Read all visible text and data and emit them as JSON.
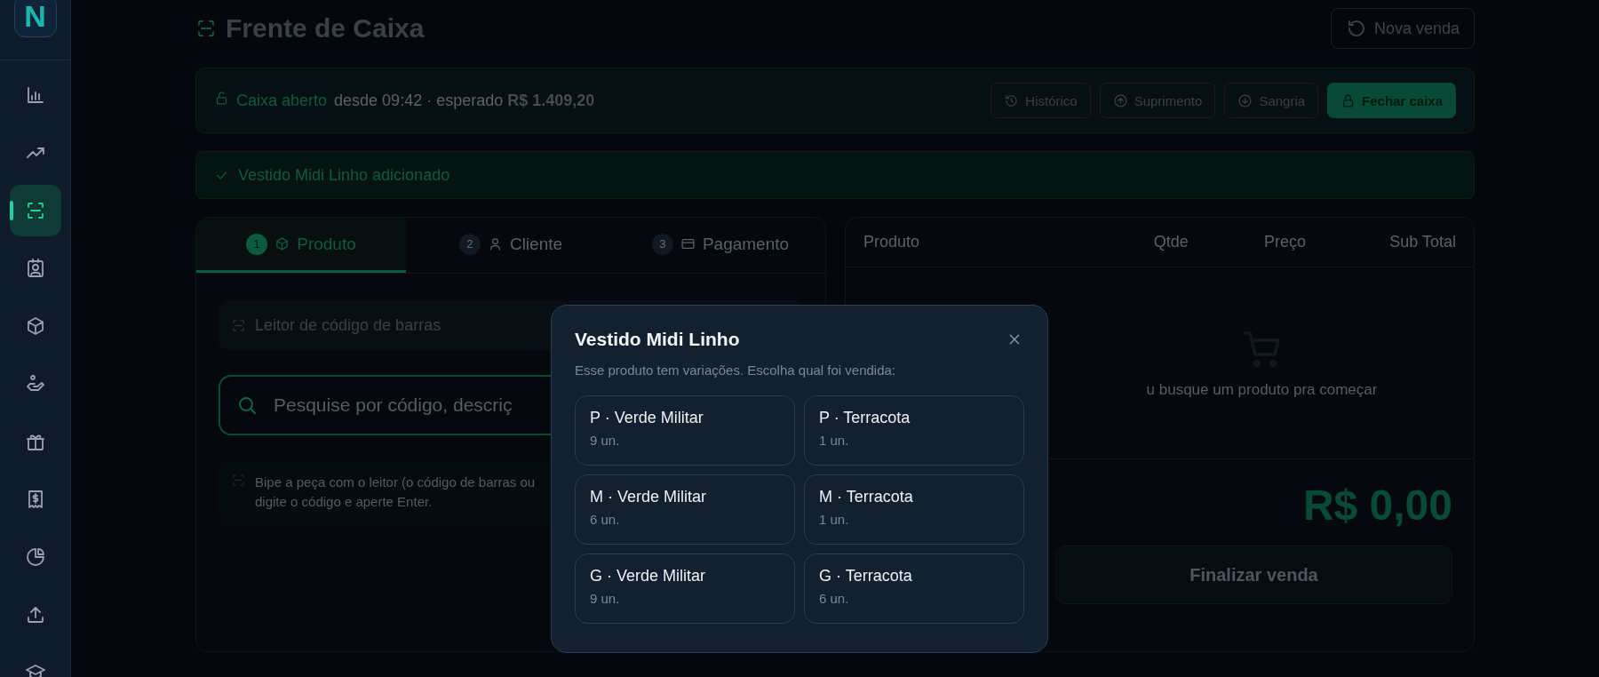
{
  "sidebar": {
    "logo": "N",
    "items": [
      {
        "selected": false
      },
      {
        "selected": false
      },
      {
        "selected": true
      },
      {
        "selected": false
      },
      {
        "selected": false
      },
      {
        "selected": false
      },
      {
        "selected": false
      },
      {
        "selected": false
      },
      {
        "selected": false
      },
      {
        "selected": false
      },
      {
        "selected": false
      }
    ]
  },
  "header": {
    "title": "Frente de Caixa",
    "new_sale_button": "Nova venda"
  },
  "cash_status": {
    "status": "Caixa aberto",
    "detail": "desde 09:42 · esperado **R$ 1.409,20**",
    "buttons": [
      {
        "label": "Histórico",
        "kind": "history"
      },
      {
        "label": "Suprimento",
        "kind": "supply"
      },
      {
        "label": "Sangria",
        "kind": "withdraw"
      },
      {
        "label": "Fechar caixa",
        "kind": "close"
      }
    ]
  },
  "alert": "Vestido Midi Linho adicionado",
  "steps": [
    {
      "number": "1",
      "label": "Produto",
      "selected": true
    },
    {
      "number": "2",
      "label": "Cliente",
      "selected": false
    },
    {
      "number": "3",
      "label": "Pagamento",
      "selected": false
    }
  ],
  "barcode_reader": "Leitor de código de barras",
  "search": {
    "placeholder": "Pesquise por código, descriç"
  },
  "hint": "Bipe a peça com o leitor (o código de barras ou digite o código e aperte Enter.",
  "cart": {
    "columns": [
      "Produto",
      "Qtde",
      "Preço",
      "Sub Total"
    ],
    "empty_message": "u busque um produto pra começar",
    "total": "R$ 0,00",
    "finish_button": "Finalizar venda"
  },
  "modal": {
    "title": "Vestido Midi Linho",
    "subtitle": "Esse produto tem variações. Escolha qual foi vendida:",
    "variants": [
      {
        "name": "P · Verde Militar",
        "stock": "9 un."
      },
      {
        "name": "P · Terracota",
        "stock": "1 un."
      },
      {
        "name": "M · Verde Militar",
        "stock": "6 un."
      },
      {
        "name": "M · Terracota",
        "stock": "1 un."
      },
      {
        "name": "G · Verde Militar",
        "stock": "9 un."
      },
      {
        "name": "G · Terracota",
        "stock": "6 un."
      }
    ]
  }
}
